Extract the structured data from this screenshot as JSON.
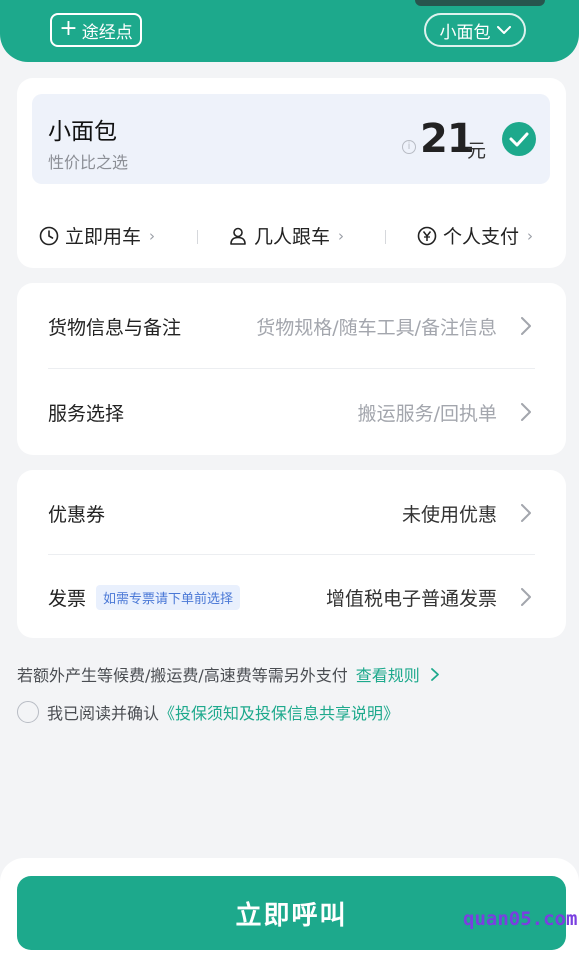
{
  "header": {
    "waypoint_label": "途经点",
    "vehicle_select": "小面包"
  },
  "vehicle": {
    "name": "小面包",
    "subtitle": "性价比之选",
    "price": "21",
    "unit": "元"
  },
  "options": [
    {
      "label": "立即用车",
      "icon": "clock-icon"
    },
    {
      "label": "几人跟车",
      "icon": "person-icon"
    },
    {
      "label": "个人支付",
      "icon": "yen-icon"
    }
  ],
  "cargo": {
    "info_label": "货物信息与备注",
    "info_placeholder": "货物规格/随车工具/备注信息",
    "service_label": "服务选择",
    "service_placeholder": "搬运服务/回执单"
  },
  "coupon": {
    "label": "优惠券",
    "value": "未使用优惠"
  },
  "invoice": {
    "label": "发票",
    "tag": "如需专票请下单前选择",
    "value": "增值税电子普通发票"
  },
  "notice": {
    "text": "若额外产生等候费/搬运费/高速费等需另外支付",
    "link": "查看规则"
  },
  "agreement": {
    "text": "我已阅读并确认",
    "link": "《投保须知及投保信息共享说明》"
  },
  "call_button": "立即呼叫",
  "watermark": "quan05.com",
  "colors": {
    "accent": "#1da98c",
    "tag_bg": "#e9f0fd",
    "tag_text": "#4a78d6"
  }
}
